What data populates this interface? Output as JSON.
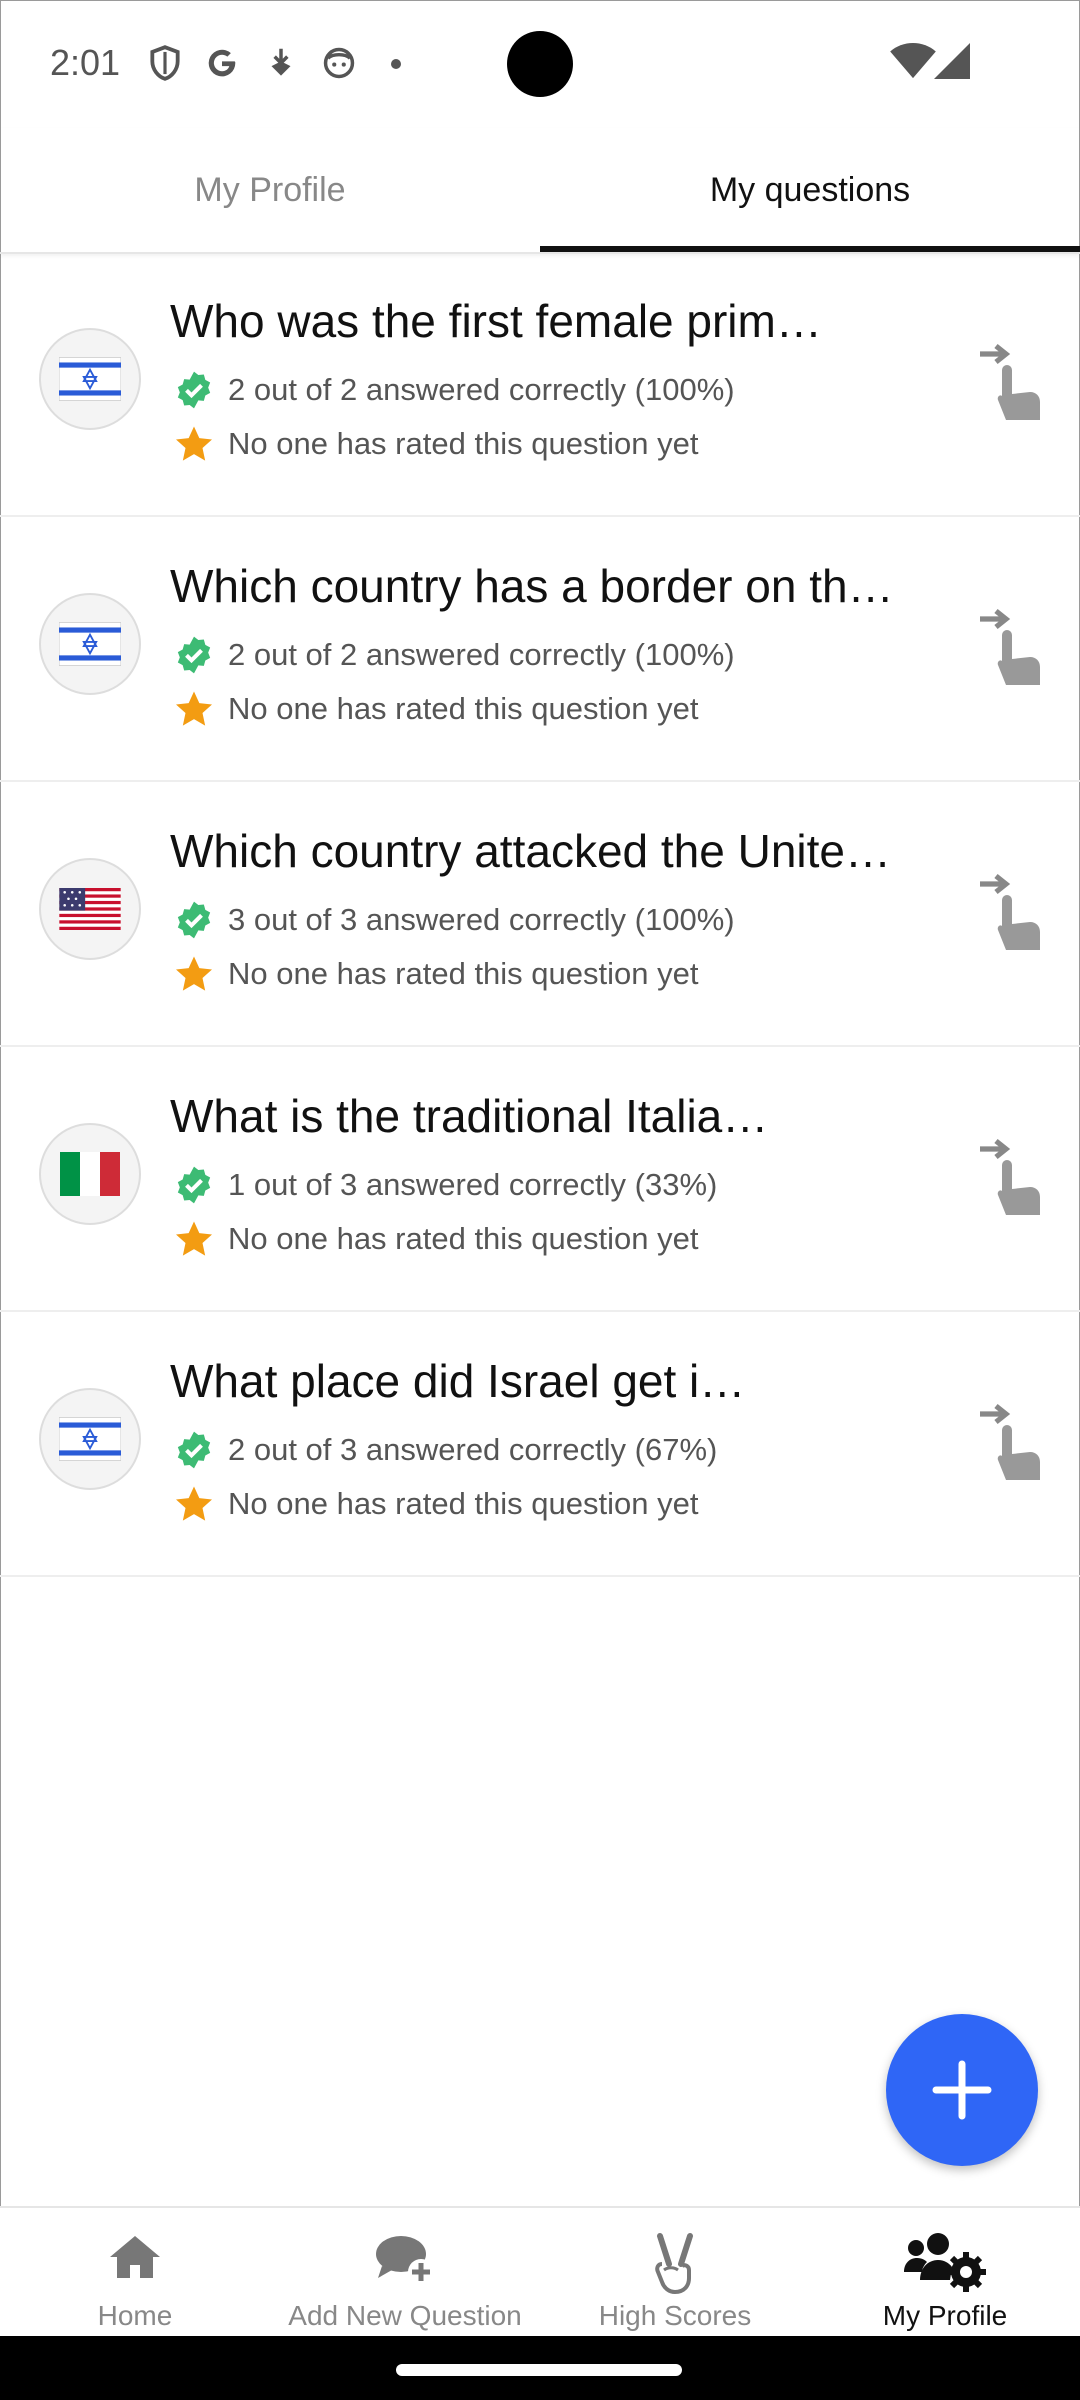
{
  "status_bar": {
    "time": "2:01",
    "icons": [
      "shield-icon",
      "google-icon",
      "download-icon",
      "face-icon",
      "dot-icon",
      "wifi-icon",
      "signal-icon"
    ]
  },
  "tabs": [
    {
      "label": "My Profile",
      "selected": false
    },
    {
      "label": "My questions",
      "selected": true
    }
  ],
  "questions": [
    {
      "title": "Who was the first female prim…",
      "flag": "israel",
      "answered": "2 out of 2 answered correctly (100%)",
      "rating": "No one has rated this question yet"
    },
    {
      "title": "Which country has a border on th…",
      "flag": "israel",
      "answered": "2 out of 2 answered correctly (100%)",
      "rating": "No one has rated this question yet"
    },
    {
      "title": "Which country attacked the Unite…",
      "flag": "usa",
      "answered": "3 out of 3 answered correctly (100%)",
      "rating": "No one has rated this question yet"
    },
    {
      "title": "What is the traditional Italia…",
      "flag": "italy",
      "answered": "1 out of 3 answered correctly (33%)",
      "rating": "No one has rated this question yet"
    },
    {
      "title": "What place did Israel get i…",
      "flag": "israel",
      "answered": "2 out of 3 answered correctly (67%)",
      "rating": "No one has rated this question yet"
    }
  ],
  "fab": {
    "icon": "plus-icon"
  },
  "bottom_nav": [
    {
      "label": "Home",
      "icon": "home-icon",
      "active": false
    },
    {
      "label": "Add New Question",
      "icon": "add-comment-icon",
      "active": false
    },
    {
      "label": "High Scores",
      "icon": "victory-hand-icon",
      "active": false
    },
    {
      "label": "My Profile",
      "icon": "users-gear-icon",
      "active": true
    }
  ],
  "colors": {
    "accent": "#2f66f6",
    "check": "#3dbb74",
    "star": "#f39c12"
  }
}
